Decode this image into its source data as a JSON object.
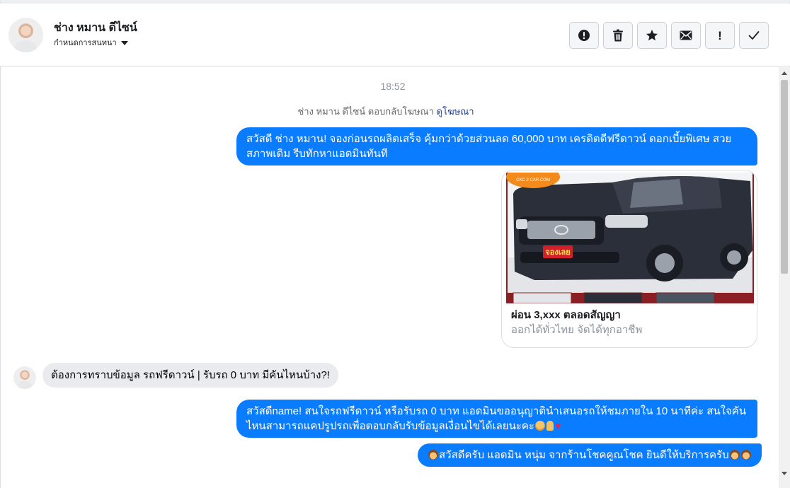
{
  "header": {
    "contact_name": "ช่าง หมาน ดีไซน์",
    "label_dropdown": "กำหนดการสนทนา",
    "toolbar": [
      {
        "name": "report-spam-button",
        "icon": "alert-circle-icon"
      },
      {
        "name": "delete-button",
        "icon": "trash-icon"
      },
      {
        "name": "star-button",
        "icon": "star-icon"
      },
      {
        "name": "mark-unread-button",
        "icon": "envelope-icon"
      },
      {
        "name": "follow-up-button",
        "icon": "exclamation-icon",
        "glyph": "!"
      },
      {
        "name": "mark-done-button",
        "icon": "checkmark-icon"
      }
    ]
  },
  "conversation": {
    "timestamp": "18:52",
    "ad_notice": {
      "text": "ช่าง หมาน ดีไซน์ ตอบกลับโฆษณา",
      "link": "ดูโฆษณา"
    },
    "messages": [
      {
        "from": "page",
        "text": "สวัสดี ช่าง หมาน! จองก่อนรถผลิตเสร็จ คุ้มกว่าด้วยส่วนลด 60,000 บาท เครดิตดีฟรีดาวน์ ดอกเบี้ยพิเศษ สวยสภาพเดิม รีบทักหาแอดมินทันที"
      },
      {
        "from": "page",
        "type": "ad_card",
        "image_alt": "รถกระบะสีดำ",
        "image_badge": "CKC 2 CAR.COM",
        "image_stamp": "จองเลย",
        "title": "ผ่อน 3,xxx ตลอดสัญญา",
        "subtitle": "ออกได้ทั่วไทย จัดได้ทุกอาชีพ"
      },
      {
        "from": "customer",
        "text": "ต้องการทราบข้อมูล รถฟรีดาวน์ | รับรถ 0 บาท มีคันไหนบ้าง?!"
      },
      {
        "from": "page",
        "text": "สวัสดีname! สนใจรถฟรีดาวน์ หรือรับรถ 0 บาท แอดมินขออนุญาตินำเสนอรถให้ชมภายใน 10 นาทีค่ะ สนใจคันไหนสามารถแคปรูปรถเพื่อตอบกลับรับข้อมูลเงื่อนไขได้เลยนะคะ",
        "emojis": [
          "smiling-hearts-emoji",
          "pray-emoji",
          "red-heart-emoji"
        ]
      },
      {
        "from": "page",
        "text": "สวัสดีครับ แอดมิน หนุ่ม จากร้านโชคคูณโชค ยินดีให้บริการครับ",
        "emojis": [
          "man-emoji",
          "man-emoji",
          "man-emoji"
        ]
      }
    ]
  },
  "colors": {
    "outgoing_bubble": "#0a7cff",
    "incoming_bubble": "#e9ebee",
    "link": "#1c3f94",
    "timestamp": "#8d949e"
  }
}
